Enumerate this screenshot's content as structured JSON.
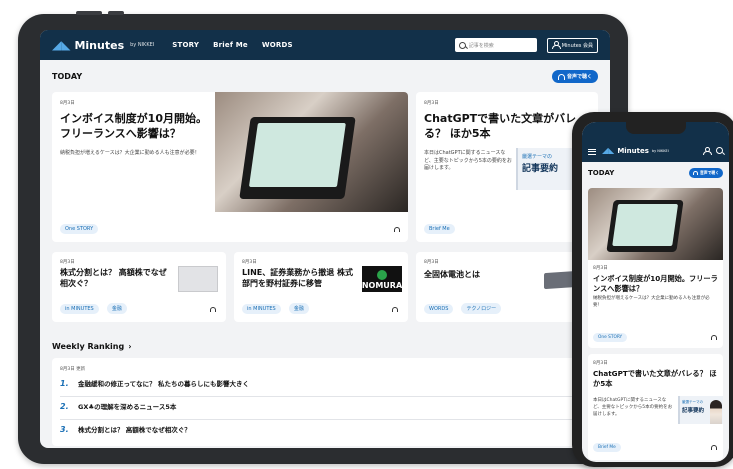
{
  "nav": {
    "logo": "Minutes",
    "logo_sub": "by NIKKEI",
    "links": [
      "STORY",
      "Brief Me",
      "WORDS"
    ],
    "search_placeholder": "記事を検索",
    "member_label": "Minutes 会員"
  },
  "today": {
    "title": "TODAY",
    "audio_button": "音声で聴く"
  },
  "cards": {
    "hero": {
      "date": "8月3日",
      "title": "インボイス制度が10月開始。フリーランスへ影響は？",
      "desc": "納税負担が増えるケースは？大企業に勤める人も注意が必要！",
      "tag": "One STORY"
    },
    "chatgpt": {
      "date": "8月3日",
      "title": "ChatGPTで書いた文章がバレる？ ほか5本",
      "desc": "本日はChatGPTに関するニュースなど、主要なトピックから5本の要約をお届けします。",
      "thumb_label": "厳選テーマの",
      "thumb_title": "記事要約",
      "tag": "Brief Me"
    },
    "kabu": {
      "date": "8月3日",
      "title": "株式分割とは？ 高額株でなぜ相次ぐ？",
      "tags": [
        "in MINUTES",
        "金融"
      ]
    },
    "line": {
      "date": "8月3日",
      "title": "LINE、証券業務から撤退 株式部門を野村証券に移管",
      "tags": [
        "in MINUTES",
        "金融"
      ],
      "nomura": "NOMURA"
    },
    "battery": {
      "date": "8月3日",
      "title": "全固体電池とは",
      "tags": [
        "WORDS",
        "テクノロジー"
      ]
    }
  },
  "ranking": {
    "title": "Weekly Ranking",
    "chevron": "›",
    "updated": "8月3日 更新",
    "items": [
      {
        "num": "1.",
        "title": "金融緩和の修正ってなに？ 私たちの暮らしにも影響大きく"
      },
      {
        "num": "2.",
        "title": "GX♣の理解を深めるニュース5本"
      },
      {
        "num": "3.",
        "title": "株式分割とは？ 高額株でなぜ相次ぐ？"
      }
    ]
  },
  "phone": {
    "logo": "Minutes",
    "logo_sub": "by NIKKEI",
    "today": "TODAY",
    "audio_button": "音声で聴く",
    "card1": {
      "date": "8月3日",
      "title": "インボイス制度が10月開始。フリーランスへ影響は？",
      "desc": "納税負担が増えるケースは？大企業に勤める人も注意が必要！",
      "tag": "One STORY"
    },
    "card2": {
      "date": "8月3日",
      "title": "ChatGPTで書いた文章がバレる？ ほか5本",
      "desc": "本日はChatGPTに関するニュースなど、主要なトピックから5本の要約をお届けします。",
      "thumb_label": "厳選テーマの",
      "thumb_title": "記事要約",
      "tag": "Brief Me"
    }
  }
}
